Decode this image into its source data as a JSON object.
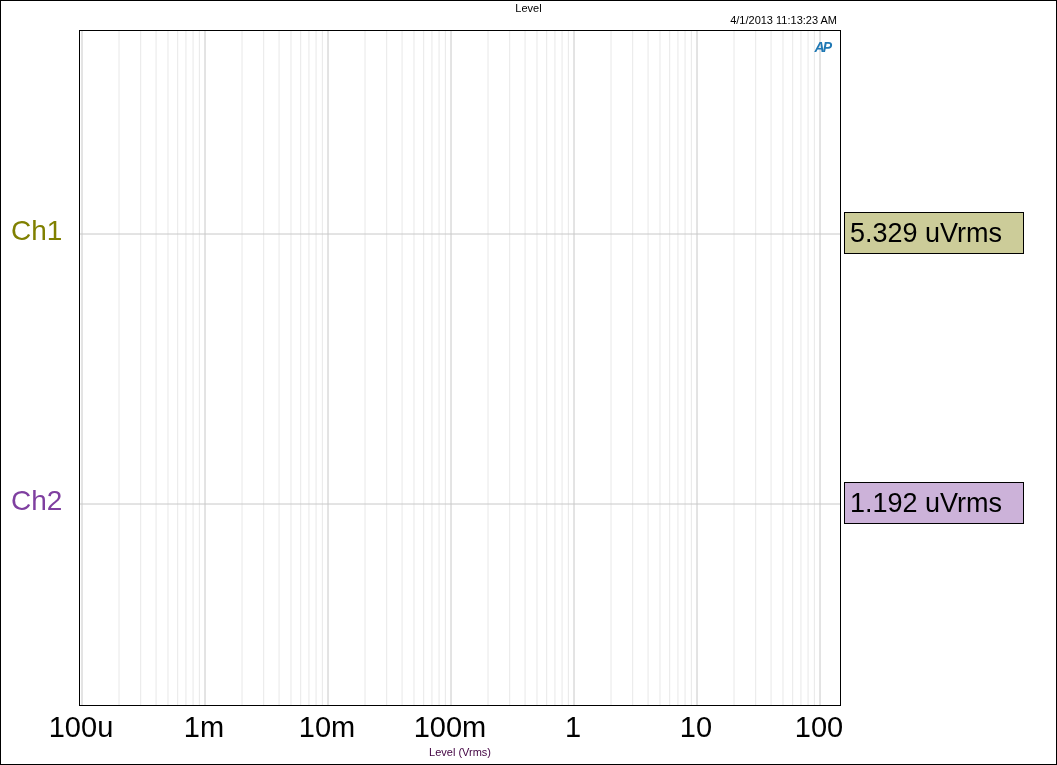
{
  "title": "Level",
  "timestamp": "4/1/2013 11:13:23 AM",
  "logo": "AP",
  "channels": [
    {
      "label": "Ch1",
      "color": "#808000",
      "reading": "5.329 uVrms"
    },
    {
      "label": "Ch2",
      "color": "#7f3fa0",
      "reading": "1.192 uVrms"
    }
  ],
  "x_axis": {
    "label": "Level (Vrms)",
    "ticks": [
      "100u",
      "1m",
      "10m",
      "100m",
      "1",
      "10",
      "100"
    ]
  }
}
